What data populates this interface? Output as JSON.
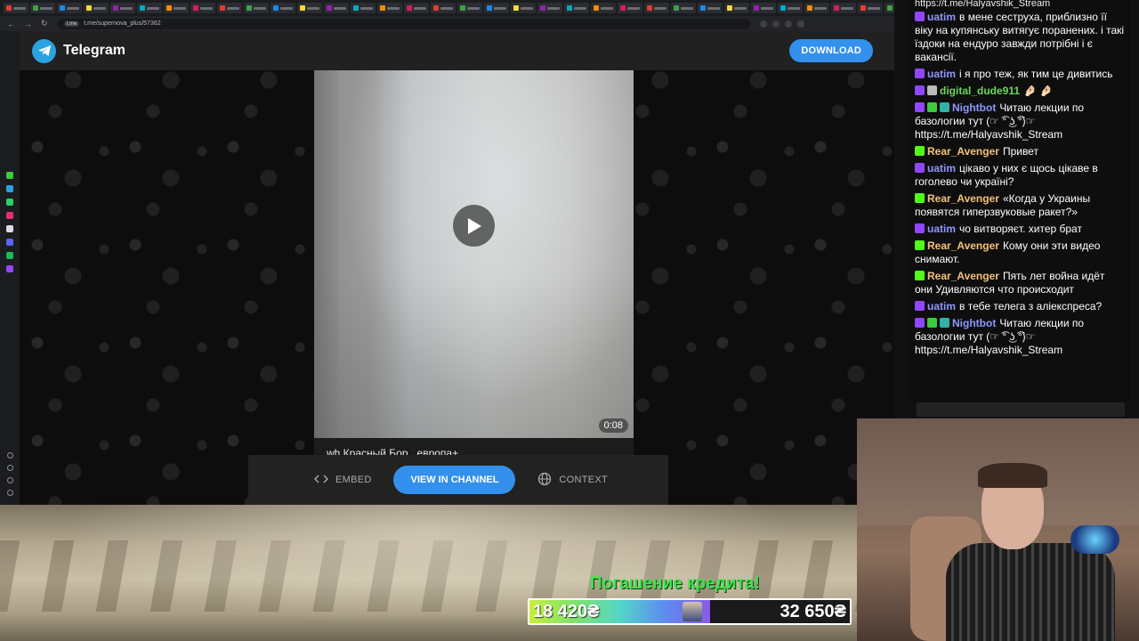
{
  "browser": {
    "url": "t.me/supernova_plus/57362",
    "secure_label": "t.me",
    "window_controls": [
      "—",
      "❐",
      "✕"
    ]
  },
  "telegram": {
    "brand": "Telegram",
    "download_label": "DOWNLOAD",
    "video": {
      "duration": "0:08",
      "caption": "wh Красный Бор , европа+"
    },
    "actions": {
      "embed": "EMBED",
      "view_channel": "VIEW IN CHANNEL",
      "context": "CONTEXT"
    }
  },
  "goal": {
    "title": "Погашение кредита!",
    "current": "18 420₴",
    "target": "32 650₴",
    "progress_fraction": 0.564
  },
  "chat": {
    "top_partial": "https://t.me/Halyavshik_Stream",
    "messages": [
      {
        "user": "uatim",
        "text": "в мене сеструха, приблизно її віку на купянську витягує поранених. і такі їздоки на ендуро завжди потрібні і є вакансії.",
        "color": "#8f97ff",
        "badges": [
          "#9146ff"
        ]
      },
      {
        "user": "uatim",
        "text": "і я про теж, як тим це дивитись",
        "color": "#8f97ff",
        "badges": [
          "#9146ff"
        ]
      },
      {
        "user": "digital_dude911",
        "text": "🤌🏻 🤌🏻",
        "color": "#6cd65a",
        "badges": [
          "#9146ff",
          "#bbbbbb"
        ]
      },
      {
        "user": "Nightbot",
        "text": "Читаю лекции по базологии тут (☞ ͡° ͜ʖ ͡°)☞ https://t.me/Halyavshik_Stream",
        "color": "#8f97ff",
        "badges": [
          "#9146ff",
          "#3ec93e",
          "#2fb3a8"
        ]
      },
      {
        "user": "Rear_Avenger",
        "text": "Привет",
        "color": "#f4c27a",
        "badges": [
          "#53fc18"
        ]
      },
      {
        "user": "uatim",
        "text": "цікаво у них є щось цікаве в гоголево чи україні?",
        "color": "#8f97ff",
        "badges": [
          "#9146ff"
        ]
      },
      {
        "user": "Rear_Avenger",
        "text": "«Когда у Украины появятся гиперзвуковые ракет?»",
        "color": "#f4c27a",
        "badges": [
          "#53fc18"
        ]
      },
      {
        "user": "uatim",
        "text": "чо витворяєт. хитер брат",
        "color": "#8f97ff",
        "badges": [
          "#9146ff"
        ]
      },
      {
        "user": "Rear_Avenger",
        "text": "Кому они эти видео снимают.",
        "color": "#f4c27a",
        "badges": [
          "#53fc18"
        ]
      },
      {
        "user": "Rear_Avenger",
        "text": "Пять лет война идёт они Удивляются что происходит",
        "color": "#f4c27a",
        "badges": [
          "#53fc18"
        ]
      },
      {
        "user": "uatim",
        "text": "в тебе телега з аліекспреса?",
        "color": "#8f97ff",
        "badges": [
          "#9146ff"
        ]
      },
      {
        "user": "Nightbot",
        "text": "Читаю лекции по базологии тут (☞ ͡° ͜ʖ ͡°)☞ https://t.me/Halyavshik_Stream",
        "color": "#8f97ff",
        "badges": [
          "#9146ff",
          "#3ec93e",
          "#2fb3a8"
        ]
      }
    ]
  },
  "colors": {
    "telegram_blue": "#3390ec",
    "telegram_logo": "#2aa3e0",
    "goal_green": "#3ee24a"
  },
  "icons": {
    "embed": "code-brackets-icon",
    "context": "globe-icon",
    "play": "play-icon",
    "logo": "telegram-plane-icon"
  }
}
